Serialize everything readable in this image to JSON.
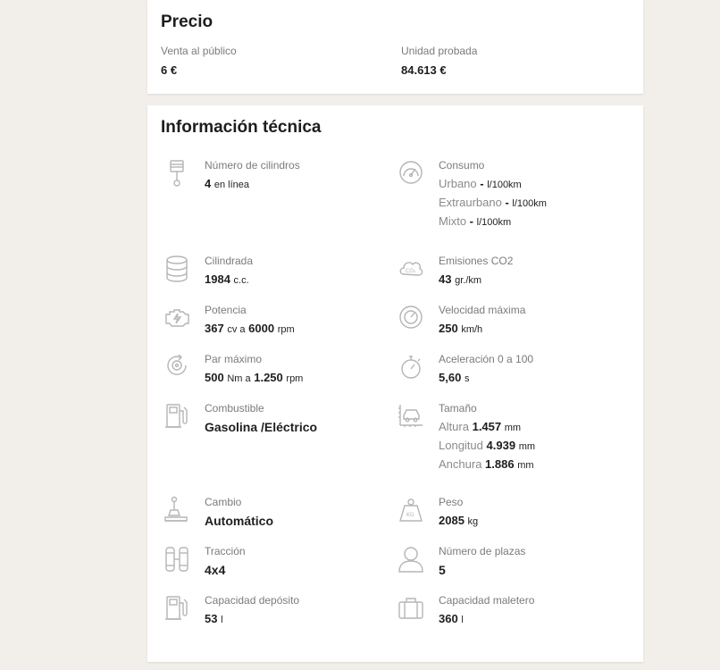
{
  "precio": {
    "title": "Precio",
    "venta_label": "Venta al público",
    "venta_value": "6 €",
    "unidad_label": "Unidad probada",
    "unidad_value": "84.613 €"
  },
  "tecnica": {
    "title": "Información técnica",
    "cilindros": {
      "label": "Número de cilindros",
      "value": "4",
      "unit": "en línea"
    },
    "consumo": {
      "label": "Consumo",
      "urbano": "Urbano",
      "extraurbano": "Extraurbano",
      "mixto": "Mixto",
      "sep": " - ",
      "unit": "l/100km"
    },
    "cilindrada": {
      "label": "Cilindrada",
      "value": "1984",
      "unit": "c.c."
    },
    "emisiones": {
      "label": "Emisiones CO2",
      "value": "43",
      "unit": "gr./km"
    },
    "potencia": {
      "label": "Potencia",
      "value": "367",
      "unit": "cv a",
      "rpm_value": "6000",
      "rpm_unit": "rpm"
    },
    "velocidad": {
      "label": "Velocidad máxima",
      "value": "250",
      "unit": "km/h"
    },
    "par": {
      "label": "Par máximo",
      "value": "500",
      "unit": "Nm a",
      "rpm_value": "1.250",
      "rpm_unit": "rpm"
    },
    "aceleracion": {
      "label": "Aceleración 0 a 100",
      "value": "5,60",
      "unit": "s"
    },
    "combustible": {
      "label": "Combustible",
      "value": "Gasolina /Eléctrico"
    },
    "tamano": {
      "label": "Tamaño",
      "altura_label": "Altura",
      "altura_value": "1.457",
      "longitud_label": "Longitud",
      "longitud_value": "4.939",
      "anchura_label": "Anchura",
      "anchura_value": "1.886",
      "unit": "mm"
    },
    "cambio": {
      "label": "Cambio",
      "value": "Automático"
    },
    "peso": {
      "label": "Peso",
      "value": "2085",
      "unit": "kg"
    },
    "traccion": {
      "label": "Tracción",
      "value": "4x4"
    },
    "plazas": {
      "label": "Número de plazas",
      "value": "5"
    },
    "deposito": {
      "label": "Capacidad depósito",
      "value": "53",
      "unit": "l"
    },
    "maletero": {
      "label": "Capacidad maletero",
      "value": "360",
      "unit": "l"
    }
  },
  "icons": {
    "cilindros": "piston-icon",
    "consumo": "gauge-icon",
    "cilindrada": "database-icon",
    "emisiones": "co2-cloud-icon",
    "potencia": "engine-icon",
    "velocidad": "speedometer-icon",
    "par": "torque-icon",
    "aceleracion": "stopwatch-icon",
    "combustible": "fuel-pump-icon",
    "tamano": "car-size-icon",
    "cambio": "gear-shift-icon",
    "peso": "weight-icon",
    "traccion": "tire-icon",
    "plazas": "person-icon",
    "deposito": "fuel-tank-icon",
    "maletero": "suitcase-icon"
  },
  "colors": {
    "icon": "#b5b5b5",
    "label": "#7b7b7b",
    "text": "#1d1d1d",
    "background": "#f2efeb"
  }
}
